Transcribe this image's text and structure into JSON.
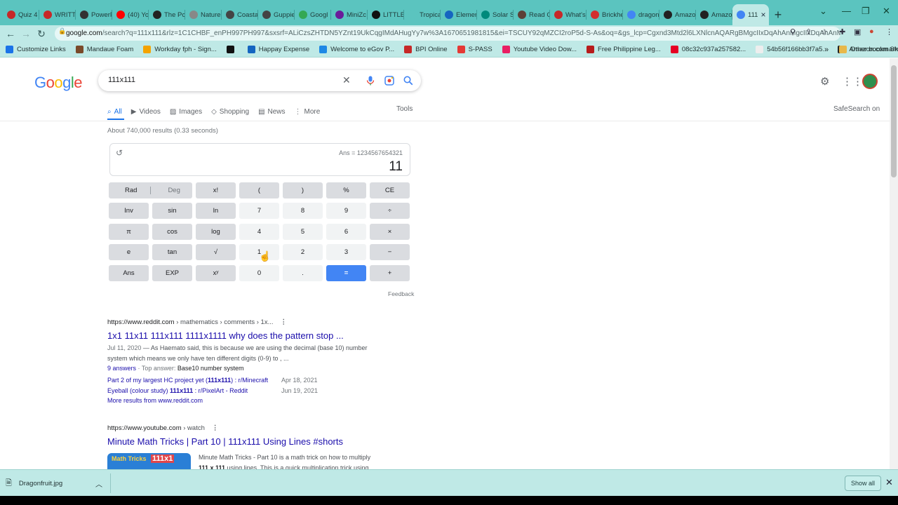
{
  "browser": {
    "tabs": [
      {
        "label": "Quiz 4",
        "color": "#c62828"
      },
      {
        "label": "WRITT",
        "color": "#c62828"
      },
      {
        "label": "PowerP",
        "color": "#333333"
      },
      {
        "label": "(40) Yo",
        "color": "#ff0000"
      },
      {
        "label": "The Pc",
        "color": "#222222"
      },
      {
        "label": "Nature",
        "color": "#888888"
      },
      {
        "label": "Coasta",
        "color": "#444444"
      },
      {
        "label": "Guppie",
        "color": "#444444"
      },
      {
        "label": "Googl",
        "color": "#34a853"
      },
      {
        "label": "MiniZc",
        "color": "#6a1b9a"
      },
      {
        "label": "LITTLE",
        "color": "#111111"
      },
      {
        "label": "Tropica",
        "color": "#5bc4bf"
      },
      {
        "label": "Elemen",
        "color": "#1565c0"
      },
      {
        "label": "Solar S",
        "color": "#00897b"
      },
      {
        "label": "Read C",
        "color": "#5d4037"
      },
      {
        "label": "What's",
        "color": "#c62828"
      },
      {
        "label": "Brickhe",
        "color": "#d32f2f"
      },
      {
        "label": "dragon",
        "color": "#4285f4"
      },
      {
        "label": "Amazo",
        "color": "#222222"
      },
      {
        "label": "Amazo",
        "color": "#222222"
      },
      {
        "label": "111",
        "color": "#4285f4",
        "active": true
      }
    ],
    "address": {
      "host": "google.com",
      "path": "/search?q=111x111&rlz=1C1CHBF_enPH997PH997&sxsrf=ALiCzsZHTDN5YZnt19UkCqgIMdAHugYy7w%3A1670651981815&ei=TSCUY92qMZCI2roP5d-S-As&oq=&gs_lcp=Cgxnd3Mtd2l6LXNlcnAQARgBMgcIIxDqAhAnMgcIIxDqAhAnM..."
    },
    "bookmarks": [
      {
        "label": "Customize Links",
        "color": "#1a73e8"
      },
      {
        "label": "Mandaue Foam",
        "color": "#7a4a2a"
      },
      {
        "label": "Workday fph - Sign...",
        "color": "#f4a300"
      },
      {
        "label": "",
        "color": "#111111"
      },
      {
        "label": "Happay Expense",
        "color": "#1565c0"
      },
      {
        "label": "Welcome to eGov P...",
        "color": "#1e88e5"
      },
      {
        "label": "BPI Online",
        "color": "#c62828"
      },
      {
        "label": "S-PASS",
        "color": "#e53935"
      },
      {
        "label": "Youtube Video Dow...",
        "color": "#e91e63"
      },
      {
        "label": "Free Philippine Leg...",
        "color": "#b71c1c"
      },
      {
        "label": "08c32c937a257582...",
        "color": "#e60023"
      },
      {
        "label": "54b56f166bb3f7a5...",
        "color": "#eeeeee"
      },
      {
        "label": "Amazon.com Shop...",
        "color": "#222222"
      }
    ],
    "other_bookmarks": "Other bookmarks"
  },
  "google": {
    "logo": "Google",
    "query": "111x111",
    "tabs": [
      {
        "label": "All",
        "icon": "search-icon"
      },
      {
        "label": "Videos",
        "icon": "play-icon"
      },
      {
        "label": "Images",
        "icon": "image-icon"
      },
      {
        "label": "Shopping",
        "icon": "tag-icon"
      },
      {
        "label": "News",
        "icon": "news-icon"
      },
      {
        "label": "More",
        "icon": "dots-vertical-icon"
      }
    ],
    "tools": "Tools",
    "safesearch": "SafeSearch on",
    "stats": "About 740,000 results (0.33 seconds)"
  },
  "calculator": {
    "ans_line": "Ans = 1234567654321",
    "result": "11",
    "rows": [
      [
        "Rad",
        "Deg",
        "x!",
        "(",
        ")",
        "%",
        "CE"
      ],
      [
        "Inv",
        "sin",
        "ln",
        "7",
        "8",
        "9",
        "÷"
      ],
      [
        "π",
        "cos",
        "log",
        "4",
        "5",
        "6",
        "×"
      ],
      [
        "e",
        "tan",
        "√",
        "1",
        "2",
        "3",
        "−"
      ],
      [
        "Ans",
        "EXP",
        "xʸ",
        "0",
        ".",
        "=",
        "+"
      ]
    ],
    "feedback": "Feedback"
  },
  "results": [
    {
      "url_host": "https://www.reddit.com",
      "url_path": " › mathematics › comments › 1x...",
      "title": "1x1 11x11 111x111 1111x1111 why does the pattern stop ...",
      "date": "Jul 11, 2020",
      "snippet_line1": " — As Haemato said, this is because we are using the decimal (base 10) number",
      "snippet_line2": "system which means we only have ten different digits (0-9) to , ...",
      "answers_count": "9 answers",
      "top_answer_label": " · Top answer: ",
      "top_answer": "Base10 number system",
      "sublinks": [
        {
          "pre": "Part 2 of my largest HC project yet (",
          "bold": "111x111",
          "post": ") : r/Minecraft",
          "date": "Apr 18, 2021"
        },
        {
          "pre": "Eyeball (colour study) ",
          "bold": "111x111",
          "post": " : r/PixelArt - Reddit",
          "date": "Jun 19, 2021"
        }
      ],
      "more": "More results from www.reddit.com"
    },
    {
      "url_host": "https://www.youtube.com",
      "url_path": " › watch",
      "title": "Minute Math Tricks | Part 10 | 111x111 Using Lines #shorts",
      "snippet_line1": "Minute Math Tricks - Part 10 is a math trick on how to multiply",
      "snippet_bold": "111 x 111",
      "snippet_line2": " using lines. This is a quick multiplication trick using...",
      "thumb_text1": "Math Tricks",
      "thumb_text2": "111x1"
    }
  ],
  "downloads": {
    "file": "Dragonfruit.jpg",
    "show_all": "Show all"
  },
  "colors": {
    "chrome_teal": "#5bc4bf",
    "link": "#1a0dab",
    "google_blue": "#4285f4"
  }
}
